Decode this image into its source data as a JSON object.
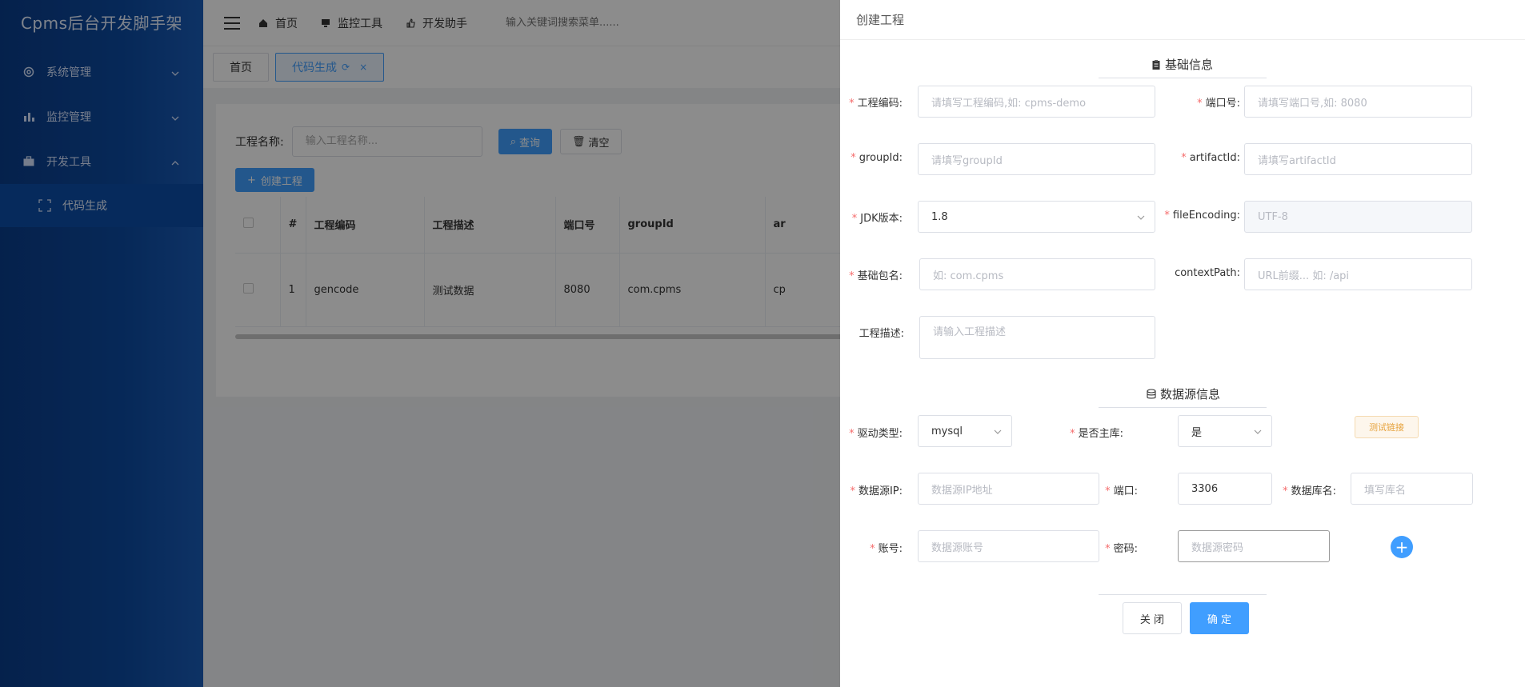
{
  "app": {
    "brand": "Cpms后台开发脚手架"
  },
  "sidebar": {
    "items": [
      {
        "label": "系统管理"
      },
      {
        "label": "监控管理"
      },
      {
        "label": "开发工具"
      }
    ],
    "sub": {
      "label": "代码生成"
    }
  },
  "header": {
    "nav": [
      {
        "label": "首页"
      },
      {
        "label": "监控工具"
      },
      {
        "label": "开发助手"
      }
    ],
    "search_placeholder": "输入关键词搜索菜单......"
  },
  "tabs": [
    {
      "label": "首页"
    },
    {
      "label": "代码生成"
    }
  ],
  "filter": {
    "label": "工程名称:",
    "placeholder": "输入工程名称...",
    "search_btn": "查询",
    "clear_btn": "清空",
    "create_btn": "创建工程"
  },
  "table": {
    "headers": [
      "#",
      "工程编码",
      "工程描述",
      "端口号",
      "groupId",
      "ar"
    ],
    "rows": [
      {
        "idx": "1",
        "code": "gencode",
        "desc": "测试数据",
        "port": "8080",
        "group": "com.cpms",
        "art": "cp"
      }
    ]
  },
  "drawer": {
    "title": "创建工程",
    "section_basic": "基础信息",
    "section_ds": "数据源信息",
    "labels": {
      "code": "工程编码:",
      "port": "端口号:",
      "group": "groupId:",
      "artifact": "artifactId:",
      "jdk": "JDK版本:",
      "encoding": "fileEncoding:",
      "pkg": "基础包名:",
      "ctx": "contextPath:",
      "desc": "工程描述:",
      "driver": "驱动类型:",
      "master": "是否主库:",
      "dsip": "数据源IP:",
      "dsport": "端口:",
      "dbname": "数据库名:",
      "account": "账号:",
      "pwd": "密码:"
    },
    "placeholders": {
      "code": "请填写工程编码,如: cpms-demo",
      "port": "请填写端口号,如: 8080",
      "group": "请填写groupId",
      "artifact": "请填写artifactId",
      "pkg": "如: com.cpms",
      "ctx": "URL前缀... 如: /api",
      "desc": "请输入工程描述",
      "dsip": "数据源IP地址",
      "dbname": "填写库名",
      "account": "数据源账号",
      "pwd": "数据源密码"
    },
    "values": {
      "jdk": "1.8",
      "encoding": "UTF-8",
      "driver": "mysql",
      "master": "是",
      "dsport": "3306"
    },
    "test_btn": "测试链接",
    "plus": "+",
    "close_btn": "关 闭",
    "ok_btn": "确 定"
  }
}
